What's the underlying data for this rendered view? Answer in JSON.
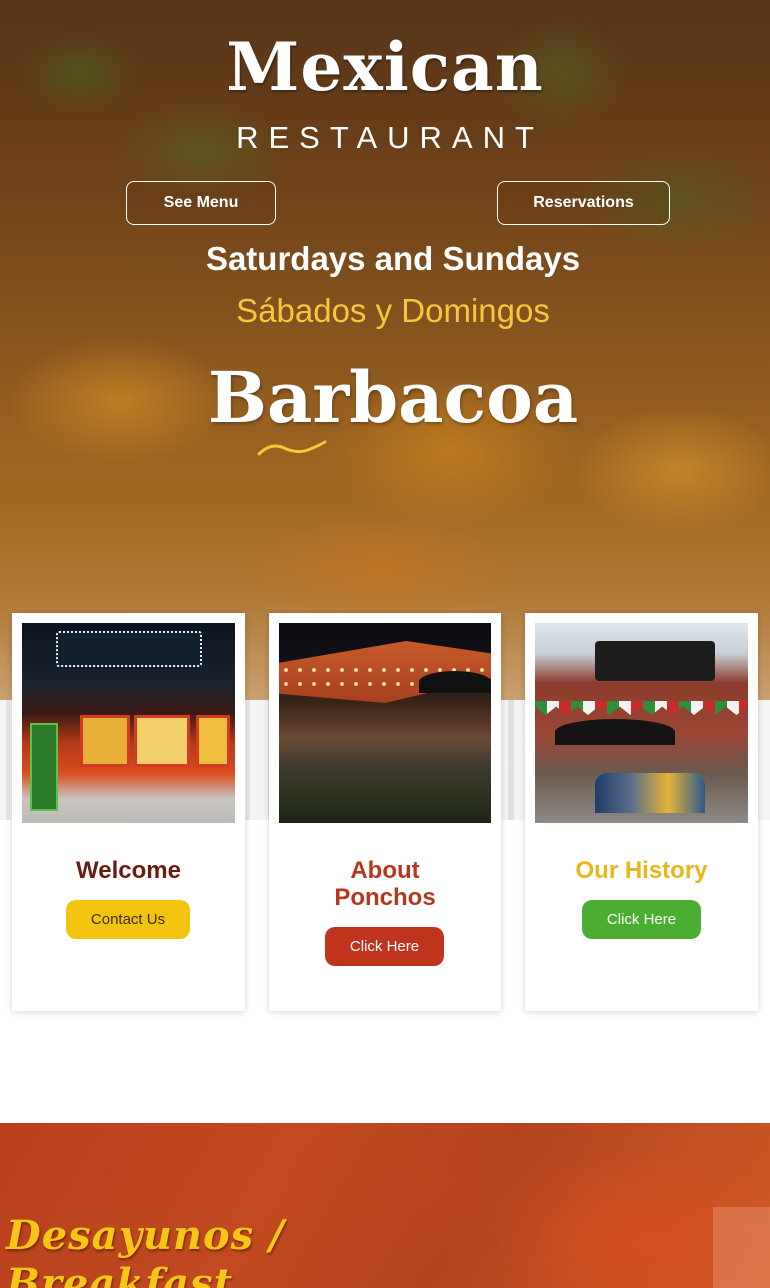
{
  "hero": {
    "logo_title": "Mexican",
    "logo_subtitle": "RESTAURANT",
    "see_menu_label": "See Menu",
    "reservations_label": "Reservations",
    "days_english": "Saturdays and Sundays",
    "days_spanish": "Sábados y Domingos",
    "special": "Barbacoa"
  },
  "cards": [
    {
      "title": "Welcome",
      "button": "Contact Us",
      "title_color": "#6b1a14",
      "button_color": "#f1c40f",
      "button_text_color": "#4a2a0a"
    },
    {
      "title": "About Ponchos",
      "button": "Click Here",
      "title_color": "#b5381e",
      "button_color": "#c0341d",
      "button_text_color": "#ffffff"
    },
    {
      "title": "Our History",
      "button": "Click Here",
      "title_color": "#e6b81c",
      "button_color": "#4bae32",
      "button_text_color": "#ffffff"
    }
  ],
  "section": {
    "title": "Desayunos / Breakfast"
  },
  "colors": {
    "accent_yellow": "#f3c83c",
    "accent_red": "#c0341d",
    "accent_green": "#4bae32"
  }
}
